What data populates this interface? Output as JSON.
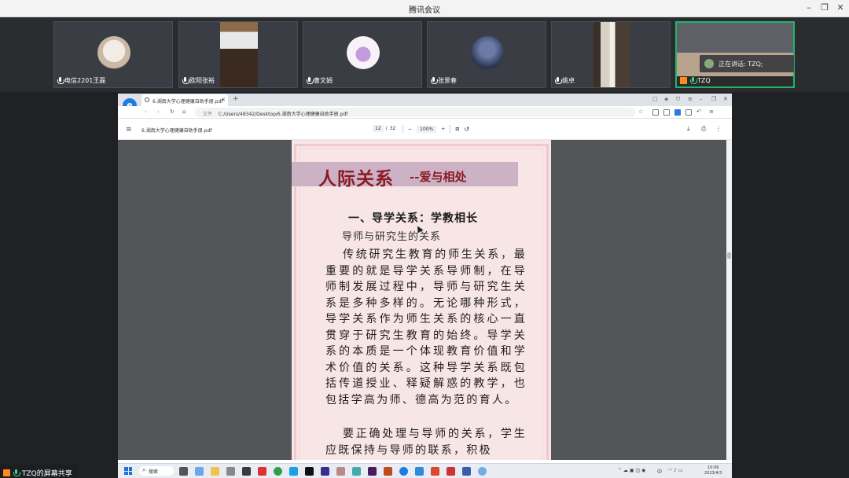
{
  "app": {
    "title": "腾讯会议"
  },
  "participants": [
    {
      "name": "电信2201王磊",
      "muted": true
    },
    {
      "name": "欧阳张裕",
      "muted": true
    },
    {
      "name": "曹文娟",
      "muted": true
    },
    {
      "name": "张景春",
      "muted": true
    },
    {
      "name": "姚卓",
      "muted": true
    },
    {
      "name": "TZQ",
      "muted": false,
      "speaking": true
    }
  ],
  "speaking_indicator": "正在讲话: TZQ;",
  "screen_share_label": "TZQ的屏幕共享",
  "browser": {
    "tab_title": "6.湖南大学心理健康自助手册.pdf",
    "url_prefix": "文件",
    "url": "C:/Users/48342/Desktop/6.湖南大学心理健康自助手册.pdf"
  },
  "pdf": {
    "filename": "6.湖南大学心理健康自助手册.pdf",
    "page_current": "12",
    "page_sep": "/",
    "page_total": "32",
    "zoom": "100%",
    "banner_big": "人际关系",
    "banner_small": "--爱与相处",
    "heading1": "一、导学关系：学教相长",
    "heading2": "导师与研究生的关系",
    "para1": "传统研究生教育的师生关系，最重要的就是导学关系导师制，在导师制发展过程中，导师与研究生关系是多种多样的。无论哪种形式，导学关系作为师生关系的核心一直贯穿于研究生教育的始终。导学关系的本质是一个体现教育价值和学术价值的关系。这种导学关系既包括传道授业、释疑解惑的教学，也包括学高为师、德高为范的育人。",
    "para2": "要正确处理与导师的关系，学生应既保持与导师的联系，积极"
  },
  "taskbar": {
    "search_label": "搜索",
    "time": "10:06",
    "date": "2023/4/3",
    "tray_lang": "中"
  },
  "colors": {
    "speaking_border": "#22b46b",
    "banner_text": "#8b1a24",
    "page_bg": "#f8e5e6"
  }
}
